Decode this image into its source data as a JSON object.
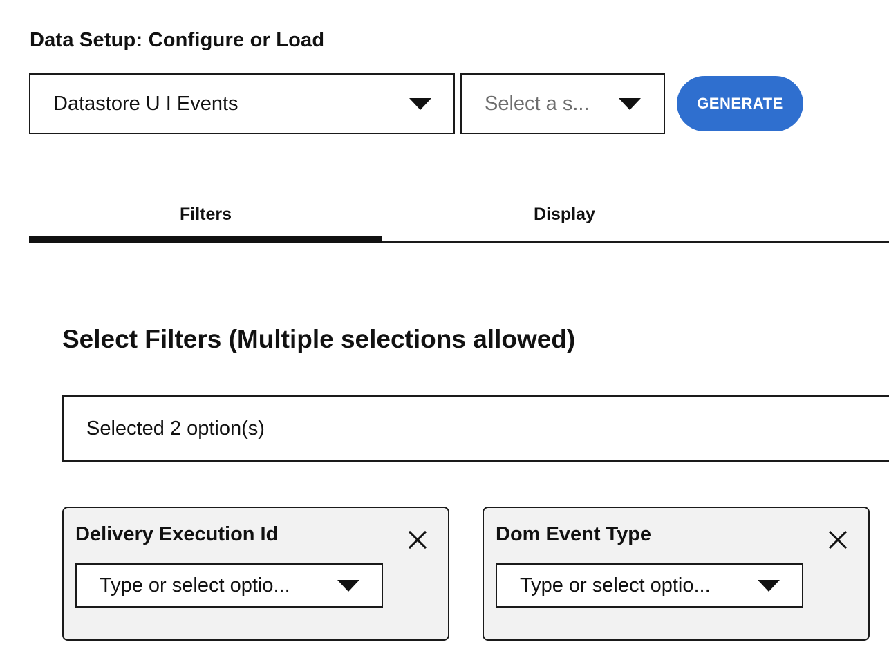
{
  "setup": {
    "title": "Data Setup: Configure or Load",
    "datastore_select": {
      "value": "Datastore U I Events",
      "icon": "caret-down-icon"
    },
    "source_select": {
      "placeholder": "Select a s...",
      "icon": "caret-down-icon"
    },
    "generate_label": "GENERATE",
    "accent_color": "#2f6fcf"
  },
  "tabs": [
    {
      "label": "Filters",
      "active": true
    },
    {
      "label": "Display",
      "active": false
    }
  ],
  "filters": {
    "heading": "Select Filters (Multiple selections allowed)",
    "multi_select_value": "Selected 2 option(s)",
    "cards": [
      {
        "title": "Delivery Execution Id",
        "placeholder": "Type or select optio...",
        "close_icon": "close-icon"
      },
      {
        "title": "Dom Event Type",
        "placeholder": "Type or select optio...",
        "close_icon": "close-icon"
      }
    ]
  }
}
